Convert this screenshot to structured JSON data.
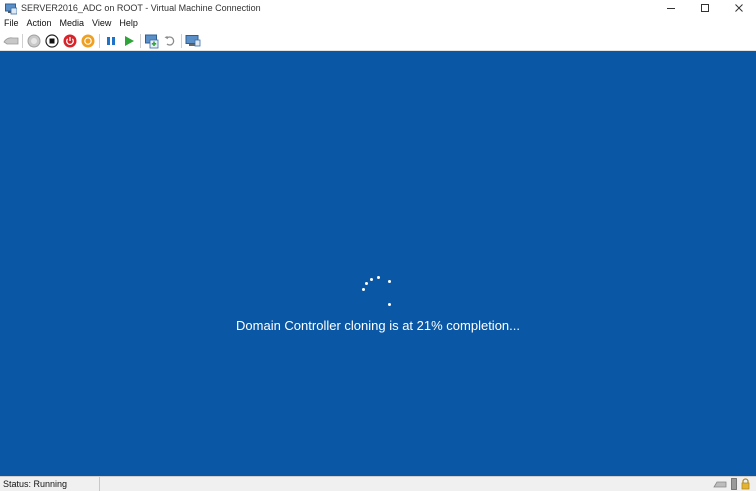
{
  "window": {
    "title": "SERVER2016_ADC on ROOT - Virtual Machine Connection",
    "icon": "vm-connection-icon"
  },
  "window_controls": [
    {
      "name": "minimize-button",
      "icon": "minimize-icon"
    },
    {
      "name": "maximize-button",
      "icon": "maximize-icon"
    },
    {
      "name": "close-button",
      "icon": "close-icon"
    }
  ],
  "menu": {
    "items": [
      "File",
      "Action",
      "Media",
      "View",
      "Help"
    ]
  },
  "toolbar": {
    "buttons": [
      {
        "name": "ctrl-alt-del-button",
        "icon": "keyboard-icon"
      },
      {
        "name": "start-button",
        "icon": "start-icon"
      },
      {
        "name": "turn-off-button",
        "icon": "stop-square-icon"
      },
      {
        "name": "shut-down-button",
        "icon": "power-red-icon"
      },
      {
        "name": "save-button",
        "icon": "save-orange-icon"
      },
      {
        "name": "pause-button",
        "icon": "pause-icon"
      },
      {
        "name": "resume-button",
        "icon": "play-icon"
      },
      {
        "name": "checkpoint-button",
        "icon": "checkpoint-icon"
      },
      {
        "name": "revert-button",
        "icon": "revert-icon"
      },
      {
        "name": "enhanced-session-button",
        "icon": "enhanced-session-icon"
      }
    ]
  },
  "guest_screen": {
    "background_color": "#0a58a5",
    "message": "Domain Controller cloning is at 21% completion...",
    "progress_percent": 21
  },
  "status_bar": {
    "status": "Status: Running",
    "icons": [
      "keyboard-status-icon",
      "usb-status-icon",
      "lock-status-icon"
    ]
  }
}
